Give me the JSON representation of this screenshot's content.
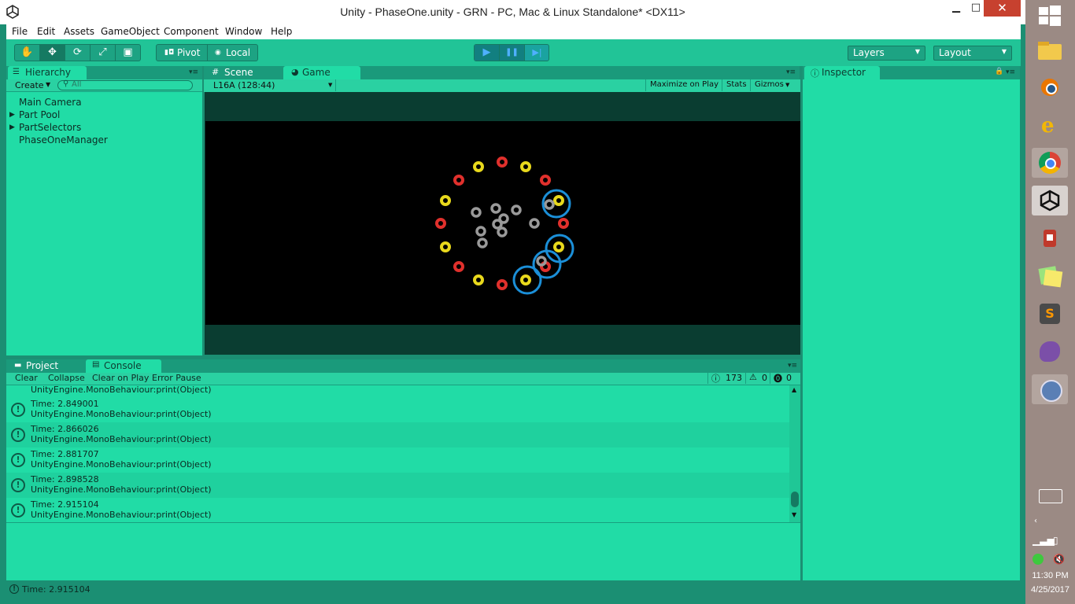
{
  "window": {
    "title": "Unity - PhaseOne.unity - GRN - PC, Mac & Linux Standalone* <DX11>",
    "minimize": "▁",
    "maximize": "□",
    "close": "✕"
  },
  "menu": [
    "File",
    "Edit",
    "Assets",
    "GameObject",
    "Component",
    "Window",
    "Help"
  ],
  "toolbar": {
    "tools": [
      "hand-tool-icon",
      "move-tool-icon",
      "rotate-tool-icon",
      "scale-tool-icon",
      "rect-tool-icon"
    ],
    "pivot": "Pivot",
    "local": "Local",
    "play": "▶",
    "pause": "❚❚",
    "step": "▶|",
    "layers": "Layers",
    "layout": "Layout"
  },
  "hierarchy": {
    "tab": "Hierarchy",
    "create": "Create",
    "search_placeholder": "All",
    "items": [
      {
        "label": "Main Camera",
        "expandable": false
      },
      {
        "label": "Part Pool",
        "expandable": true
      },
      {
        "label": "PartSelectors",
        "expandable": true
      },
      {
        "label": "PhaseOneManager",
        "expandable": false
      }
    ]
  },
  "scene_tab": "Scene",
  "game": {
    "tab": "Game",
    "resolution": "L16A (128:44)",
    "maximize_on_play": "Maximize on Play",
    "stats": "Stats",
    "gizmos": "Gizmos"
  },
  "inspector_tab": "Inspector",
  "project_tab": "Project",
  "console": {
    "tab": "Console",
    "buttons": [
      "Clear",
      "Collapse",
      "Clear on Play",
      "Error Pause"
    ],
    "counts": {
      "info": "173",
      "warn": "0",
      "error": "0"
    },
    "partial_first": "UnityEngine.MonoBehaviour:print(Object)",
    "rows": [
      {
        "time": "Time: 2.849001",
        "trace": "UnityEngine.MonoBehaviour:print(Object)"
      },
      {
        "time": "Time: 2.866026",
        "trace": "UnityEngine.MonoBehaviour:print(Object)"
      },
      {
        "time": "Time: 2.881707",
        "trace": "UnityEngine.MonoBehaviour:print(Object)"
      },
      {
        "time": "Time: 2.898528",
        "trace": "UnityEngine.MonoBehaviour:print(Object)"
      },
      {
        "time": "Time: 2.915104",
        "trace": "UnityEngine.MonoBehaviour:print(Object)"
      }
    ]
  },
  "status": "Time: 2.915104",
  "clock": {
    "time": "11:30 PM",
    "date": "4/25/2017"
  },
  "colors": {
    "panel": "#21dca6",
    "frame": "#1b8f73",
    "red_ring": "#e0302c",
    "yellow_ring": "#e8d81c",
    "gray_ring": "#9a9a9a",
    "highlight": "#1b8fd8"
  }
}
